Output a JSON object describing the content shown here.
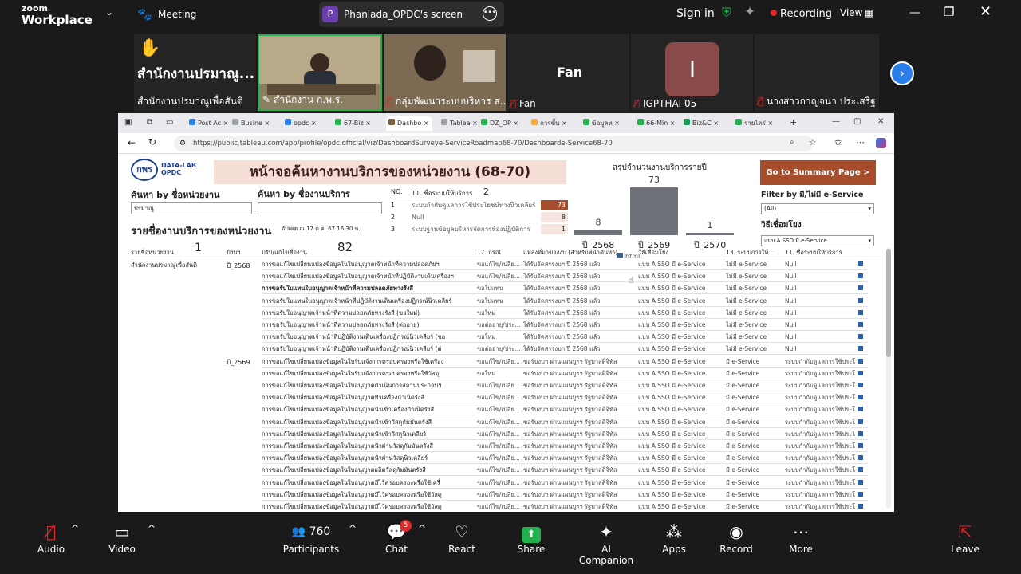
{
  "zoom": {
    "logo_line1": "zoom",
    "logo_line2": "Workplace",
    "meeting_label": "Meeting",
    "share_avatar": "P",
    "share_title": "Phanlada_OPDC's screen",
    "signin": "Sign in",
    "recording": "Recording",
    "view": "View",
    "colors": {
      "bg": "#1a1a1a",
      "recording": "#e02828",
      "shield": "#22b14c",
      "share": "#22b14c"
    }
  },
  "participants_tiles": [
    {
      "label": "สำนักงานปรมาณูเพื่อสันติ",
      "big": "สำนักงานปรมาณู...",
      "icon": "raised-hand"
    },
    {
      "label": "สำนักงาน ก.พ.ร.",
      "icon": "video"
    },
    {
      "label": "กลุ่มพัฒนาระบบบริหาร ส...",
      "icon": "video"
    },
    {
      "label": "Fan",
      "big": "Fan"
    },
    {
      "label": "IGPTHAI 05",
      "big": "I"
    },
    {
      "label": "นางสาวกาญจนา ประเสริฐ ..."
    }
  ],
  "browser": {
    "tabs": [
      "Post Ac",
      "Busine",
      "opdc",
      "67-Biz",
      "Dashbo",
      "Tablea",
      "DZ_OP",
      "การขั้น",
      "ข้อมูลห",
      "66-Min",
      "Biz&C",
      "รายไตร่"
    ],
    "url": "https://public.tableau.com/app/profile/opdc.official/viz/DashboardSurveye-ServiceRoadmap68-70/Dashboarde-Service68-70"
  },
  "dashboard": {
    "logo_text": "DATA-LAB",
    "logo_sub": "OPDC",
    "title": "หน้าจอค้นหางานบริการของหน่วยงาน (68-70)",
    "search_agency_label": "ค้นหา by ชื่อหน่วยงาน",
    "search_agency_value": "ปรมาณู",
    "search_service_label": "ค้นหา by ชื่องานบริการ",
    "summary_button": "Go to Summary Page >",
    "filter_label": "Filter by มี/ไม่มี e-Service",
    "filter_value": "(All)",
    "method_label": "วิธีเชื่อมโยง",
    "method_value": "แบบ A SSO มี e-Service",
    "system_table": {
      "header_no": "NO.",
      "header_name": "11. ชื่อระบบให้บริการ",
      "count": "2",
      "rows": [
        {
          "no": "1",
          "name": "ระบบกำกับดูแลการใช้ประโยชน์ทางนิวเคลียร์",
          "value": "73"
        },
        {
          "no": "2",
          "name": "Null",
          "value": "8"
        },
        {
          "no": "3",
          "name": "ระบบฐานข้อมูลบริหารจัดการห้องปฏิบัติการ",
          "value": "1"
        }
      ]
    },
    "chart_data": {
      "type": "bar",
      "title": "สรุปจำนวนงานบริการรายปี",
      "categories": [
        "ปี_2568",
        "ปี_2569",
        "ปี_2570"
      ],
      "values": [
        8,
        73,
        1
      ],
      "legend": "html",
      "colors": [
        "#6e7178"
      ]
    },
    "list_title": "รายชื่องานบริการของหน่วยงาน",
    "update_note": "อัปเดต ณ 17 ต.ค. 67 16.30 น.",
    "agency_count": "1",
    "service_count": "82",
    "columns": [
      "รายชื่อหน่วยงาน",
      "ปีงบฯ",
      "ปรับ/แก้ไขชื่องาน",
      "17. กรณี",
      "แหล่งที่มาของงบ (สำหรับหน้าคันหา)",
      "วิธีเชื่อมโยง",
      "13. ระบบการให้...",
      "11. ชื่อระบบให้บริการ"
    ],
    "agency_name": "สำนักงานปรมาณูเพื่อสันติ",
    "year_groups": [
      "ปี_2568",
      "ปี_2569"
    ],
    "rows": [
      {
        "name": "การขอแก้ไขเปลี่ยนแปลงข้อมูลในใบอนุญาตเจ้าหน้าที่ความปลอดภัยฯ",
        "c17": "ขอแก้ไข/เปลี่ย...",
        "src": "ได้รับจัดสรรงบฯ ปี 2568 แล้ว",
        "way": "แบบ A SSO มี e-Service",
        "sys": "ไม่มี e-Service",
        "name11": "Null"
      },
      {
        "name": "การขอแก้ไขเปลี่ยนแปลงข้อมูลในใบอนุญาตเจ้าหน้าที่ปฏิบัติงานเดินเครื่องฯ",
        "c17": "ขอแก้ไข/เปลี่ย...",
        "src": "ได้รับจัดสรรงบฯ ปี 2568 แล้ว",
        "way": "แบบ A SSO มี e-Service",
        "sys": "ไม่มี e-Service",
        "name11": "Null"
      },
      {
        "name": "การขอรับใบแทนใบอนุญาตเจ้าหน้าที่ความปลอดภัยทางรังสี",
        "c17": "ขอใบแทน",
        "src": "ได้รับจัดสรรงบฯ ปี 2568 แล้ว",
        "way": "แบบ A SSO มี e-Service",
        "sys": "ไม่มี e-Service",
        "name11": "Null"
      },
      {
        "name": "การขอรับใบแทนใบอนุญาตเจ้าหน้าที่ปฏิบัติงานเดินเครื่องปฏิกรณ์นิวเคลียร์",
        "c17": "ขอใบแทน",
        "src": "ได้รับจัดสรรงบฯ ปี 2568 แล้ว",
        "way": "แบบ A SSO มี e-Service",
        "sys": "ไม่มี e-Service",
        "name11": "Null"
      },
      {
        "name": "การขอรับใบอนุญาตเจ้าหน้าที่ความปลอดภัยทางรังสี (ขอใหม่)",
        "c17": "ขอใหม่",
        "src": "ได้รับจัดสรรงบฯ ปี 2568 แล้ว",
        "way": "แบบ A SSO มี e-Service",
        "sys": "ไม่มี e-Service",
        "name11": "Null"
      },
      {
        "name": "การขอรับใบอนุญาตเจ้าหน้าที่ความปลอดภัยทางรังสี (ต่ออายุ)",
        "c17": "ขอต่ออายุ/ประ...",
        "src": "ได้รับจัดสรรงบฯ ปี 2568 แล้ว",
        "way": "แบบ A SSO มี e-Service",
        "sys": "ไม่มี e-Service",
        "name11": "Null"
      },
      {
        "name": "การขอรับใบอนุญาตเจ้าหน้าที่ปฏิบัติงานเดินเครื่องปฏิกรณ์นิวเคลียร์ (ขอ",
        "c17": "ขอใหม่",
        "src": "ได้รับจัดสรรงบฯ ปี 2568 แล้ว",
        "way": "แบบ A SSO มี e-Service",
        "sys": "ไม่มี e-Service",
        "name11": "Null"
      },
      {
        "name": "การขอรับใบอนุญาตเจ้าหน้าที่ปฏิบัติงานเดินเครื่องปฏิกรณ์นิวเคลียร์ (ต่",
        "c17": "ขอต่ออายุ/ประ...",
        "src": "ได้รับจัดสรรงบฯ ปี 2568 แล้ว",
        "way": "แบบ A SSO มี e-Service",
        "sys": "ไม่มี e-Service",
        "name11": "Null"
      },
      {
        "name": "การขอแก้ไขเปลี่ยนแปลงข้อมูลในใบรับแจ้งการครอบครองหรือใช้เครื่อง",
        "c17": "ขอแก้ไข/เปลี่ย...",
        "src": "ขอรับงบฯ ผ่านแผนบูรฯ รัฐบาลดิจิทัล",
        "way": "แบบ A SSO มี e-Service",
        "sys": "มี e-Service",
        "name11": "ระบบกำกับดูแลการใช้ประโ"
      },
      {
        "name": "การขอแก้ไขเปลี่ยนแปลงข้อมูลในใบรับแจ้งการครอบครองหรือใช้วัสดุ",
        "c17": "ขอใหม่",
        "src": "ขอรับงบฯ ผ่านแผนบูรฯ รัฐบาลดิจิทัล",
        "way": "แบบ A SSO มี e-Service",
        "sys": "มี e-Service",
        "name11": "ระบบกำกับดูแลการใช้ประโ"
      },
      {
        "name": "การขอแก้ไขเปลี่ยนแปลงข้อมูลในใบอนุญาตดำเนินการสถานประกอบฯ",
        "c17": "ขอแก้ไข/เปลี่ย...",
        "src": "ขอรับงบฯ ผ่านแผนบูรฯ รัฐบาลดิจิทัล",
        "way": "แบบ A SSO มี e-Service",
        "sys": "มี e-Service",
        "name11": "ระบบกำกับดูแลการใช้ประโ"
      },
      {
        "name": "การขอแก้ไขเปลี่ยนแปลงข้อมูลในใบอนุญาตทำเครื่องกำเนิดรังสี",
        "c17": "ขอแก้ไข/เปลี่ย...",
        "src": "ขอรับงบฯ ผ่านแผนบูรฯ รัฐบาลดิจิทัล",
        "way": "แบบ A SSO มี e-Service",
        "sys": "มี e-Service",
        "name11": "ระบบกำกับดูแลการใช้ประโ"
      },
      {
        "name": "การขอแก้ไขเปลี่ยนแปลงข้อมูลในใบอนุญาตนำเข้าเครื่องกำเนิดรังสี",
        "c17": "ขอแก้ไข/เปลี่ย...",
        "src": "ขอรับงบฯ ผ่านแผนบูรฯ รัฐบาลดิจิทัล",
        "way": "แบบ A SSO มี e-Service",
        "sys": "มี e-Service",
        "name11": "ระบบกำกับดูแลการใช้ประโ"
      },
      {
        "name": "การขอแก้ไขเปลี่ยนแปลงข้อมูลในใบอนุญาตนำเข้าวัสดุกัมมันตรังสี",
        "c17": "ขอแก้ไข/เปลี่ย...",
        "src": "ขอรับงบฯ ผ่านแผนบูรฯ รัฐบาลดิจิทัล",
        "way": "แบบ A SSO มี e-Service",
        "sys": "มี e-Service",
        "name11": "ระบบกำกับดูแลการใช้ประโ"
      },
      {
        "name": "การขอแก้ไขเปลี่ยนแปลงข้อมูลในใบอนุญาตนำเข้าวัสดุนิวเคลียร์",
        "c17": "ขอแก้ไข/เปลี่ย...",
        "src": "ขอรับงบฯ ผ่านแผนบูรฯ รัฐบาลดิจิทัล",
        "way": "แบบ A SSO มี e-Service",
        "sys": "มี e-Service",
        "name11": "ระบบกำกับดูแลการใช้ประโ"
      },
      {
        "name": "การขอแก้ไขเปลี่ยนแปลงข้อมูลในใบอนุญาตนำผ่านวัสดุกัมมันตรังสี",
        "c17": "ขอแก้ไข/เปลี่ย...",
        "src": "ขอรับงบฯ ผ่านแผนบูรฯ รัฐบาลดิจิทัล",
        "way": "แบบ A SSO มี e-Service",
        "sys": "มี e-Service",
        "name11": "ระบบกำกับดูแลการใช้ประโ"
      },
      {
        "name": "การขอแก้ไขเปลี่ยนแปลงข้อมูลในใบอนุญาตนำผ่านวัสดุนิวเคลียร์",
        "c17": "ขอแก้ไข/เปลี่ย...",
        "src": "ขอรับงบฯ ผ่านแผนบูรฯ รัฐบาลดิจิทัล",
        "way": "แบบ A SSO มี e-Service",
        "sys": "มี e-Service",
        "name11": "ระบบกำกับดูแลการใช้ประโ"
      },
      {
        "name": "การขอแก้ไขเปลี่ยนแปลงข้อมูลในใบอนุญาตผลิตวัสดุกัมมันตรังสี",
        "c17": "ขอแก้ไข/เปลี่ย...",
        "src": "ขอรับงบฯ ผ่านแผนบูรฯ รัฐบาลดิจิทัล",
        "way": "แบบ A SSO มี e-Service",
        "sys": "มี e-Service",
        "name11": "ระบบกำกับดูแลการใช้ประโ"
      },
      {
        "name": "การขอแก้ไขเปลี่ยนแปลงข้อมูลในใบอนุญาตมีไว้ครอบครองหรือใช้เครื่",
        "c17": "ขอแก้ไข/เปลี่ย...",
        "src": "ขอรับงบฯ ผ่านแผนบูรฯ รัฐบาลดิจิทัล",
        "way": "แบบ A SSO มี e-Service",
        "sys": "มี e-Service",
        "name11": "ระบบกำกับดูแลการใช้ประโ"
      },
      {
        "name": "การขอแก้ไขเปลี่ยนแปลงข้อมูลในใบอนุญาตมีไว้ครอบครองหรือใช้วัสดุ",
        "c17": "ขอแก้ไข/เปลี่ย...",
        "src": "ขอรับงบฯ ผ่านแผนบูรฯ รัฐบาลดิจิทัล",
        "way": "แบบ A SSO มี e-Service",
        "sys": "มี e-Service",
        "name11": "ระบบกำกับดูแลการใช้ประโ"
      },
      {
        "name": "การขอแก้ไขเปลี่ยนแปลงข้อมูลในใบอนุญาตมีไว้ครอบครองหรือใช้วัสดุ",
        "c17": "ขอแก้ไข/เปลี่ย...",
        "src": "ขอรับงบฯ ผ่านแผนบูรฯ รัฐบาลดิจิทัล",
        "way": "แบบ A SSO มี e-Service",
        "sys": "มี e-Service",
        "name11": "ระบบกำกับดูแลการใช้ประโ"
      }
    ]
  },
  "toolbar": {
    "audio": "Audio",
    "video": "Video",
    "participants": "Participants",
    "participants_count": "760",
    "chat": "Chat",
    "chat_badge": "5",
    "react": "React",
    "share": "Share",
    "ai": "AI Companion",
    "apps": "Apps",
    "record": "Record",
    "more": "More",
    "leave": "Leave"
  }
}
